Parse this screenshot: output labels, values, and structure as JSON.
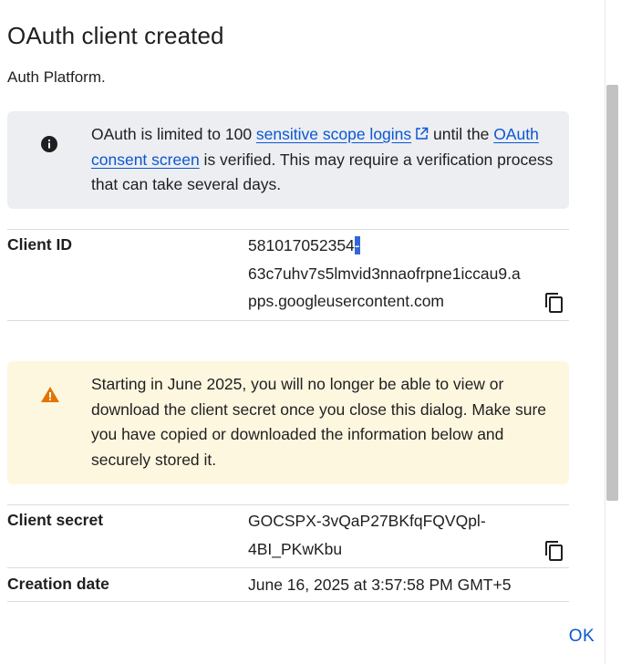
{
  "dialog": {
    "title": "OAuth client created",
    "subtitle": "Auth Platform."
  },
  "info": {
    "icon": "info-icon",
    "text_before": "OAuth is limited to 100 ",
    "link1": "sensitive scope logins",
    "link1_icon": "open-in-new-icon",
    "text_middle": " until the ",
    "link2": "OAuth consent screen",
    "text_after": " is verified. This may require a verification process that can take several days."
  },
  "client_id": {
    "label": "Client ID",
    "line1": "581017052354",
    "line1_selected": "-",
    "line2": "63c7uhv7s5lmvid3nnaofrpne1iccau9.a",
    "line3": "pps.googleusercontent.com",
    "copy_icon": "copy-icon"
  },
  "warning": {
    "icon": "warning-icon",
    "text": "Starting in June 2025, you will no longer be able to view or download the client secret once you close this dialog. Make sure you have copied or downloaded the information below and securely stored it."
  },
  "client_secret": {
    "label": "Client secret",
    "line1": "GOCSPX-3vQaP27BKfqFQVQpl-",
    "line2": "4BI_PKwKbu",
    "copy_icon": "copy-icon"
  },
  "creation_date": {
    "label": "Creation date",
    "value": "June 16, 2025 at 3:57:58 PM GMT+5"
  },
  "actions": {
    "ok": "OK"
  },
  "colors": {
    "accent": "#0b57d0",
    "info_bg": "#eceef2",
    "warning_bg": "#fef7e0",
    "warning_icon": "#e37400"
  }
}
